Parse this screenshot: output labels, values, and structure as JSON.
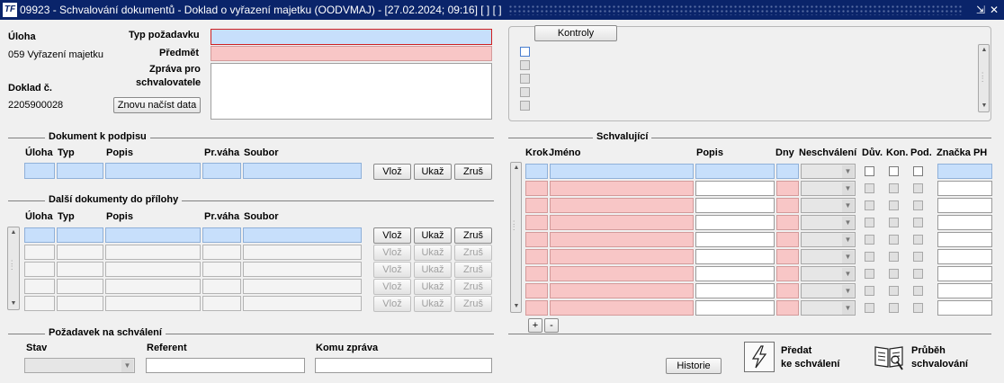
{
  "window": {
    "logo_text": "TF",
    "title": "09923 - Schvalování dokumentů - Doklad o vyřazení majetku (OODVMAJ) - [27.02.2024; 09:16] [ ] [ ]",
    "minimize_glyph": "⇲",
    "close_glyph": "✕"
  },
  "header": {
    "uloha_label": "Úloha",
    "uloha_value": "059 Vyřazení majetku",
    "doklad_label": "Doklad č.",
    "doklad_value": "2205900028",
    "reload_button": "Znovu načíst data",
    "typ_pozadavku_label": "Typ požadavku",
    "typ_pozadavku_value": "",
    "predmet_label": "Předmět",
    "predmet_value": "",
    "zprava_label_1": "Zpráva pro",
    "zprava_label_2": "schvalovatele",
    "zprava_value": ""
  },
  "kontroly": {
    "button": "Kontroly",
    "items": [
      "",
      "",
      "",
      "",
      ""
    ]
  },
  "dokument_k_podpisu": {
    "section_title": "Dokument k podpisu",
    "columns": [
      "Úloha",
      "Typ",
      "Popis",
      "Pr.váha",
      "Soubor"
    ],
    "row": [
      "",
      "",
      "",
      "",
      ""
    ],
    "buttons": [
      "Vlož",
      "Ukaž",
      "Zruš"
    ]
  },
  "dalsi_dokumenty": {
    "section_title": "Další dokumenty do přílohy",
    "columns": [
      "Úloha",
      "Typ",
      "Popis",
      "Pr.váha",
      "Soubor"
    ],
    "rows": 5,
    "buttons": [
      "Vlož",
      "Ukaž",
      "Zruš"
    ]
  },
  "pozadavek": {
    "section_title": "Požadavek na schválení",
    "stav_label": "Stav",
    "stav_value": "",
    "referent_label": "Referent",
    "referent_value": "",
    "komu_label": "Komu zpráva",
    "komu_value": ""
  },
  "schvalujici": {
    "section_title": "Schvalující",
    "columns": [
      "Krok",
      "Jméno",
      "Popis",
      "Dny",
      "Neschválení",
      "Dův.",
      "Kon.",
      "Pod.",
      "Značka PH"
    ],
    "rows": 9,
    "add_button": "+",
    "remove_button": "-"
  },
  "footer": {
    "historie_button": "Historie",
    "predat_line1": "Předat",
    "predat_line2": "ke schválení",
    "prubeh_line1": "Průběh",
    "prubeh_line2": "schvalování"
  },
  "colors": {
    "titlebar": "#0a246a",
    "required_field": "#f8c6c6",
    "key_field": "#c7dffb",
    "focused_border": "#d02020"
  }
}
